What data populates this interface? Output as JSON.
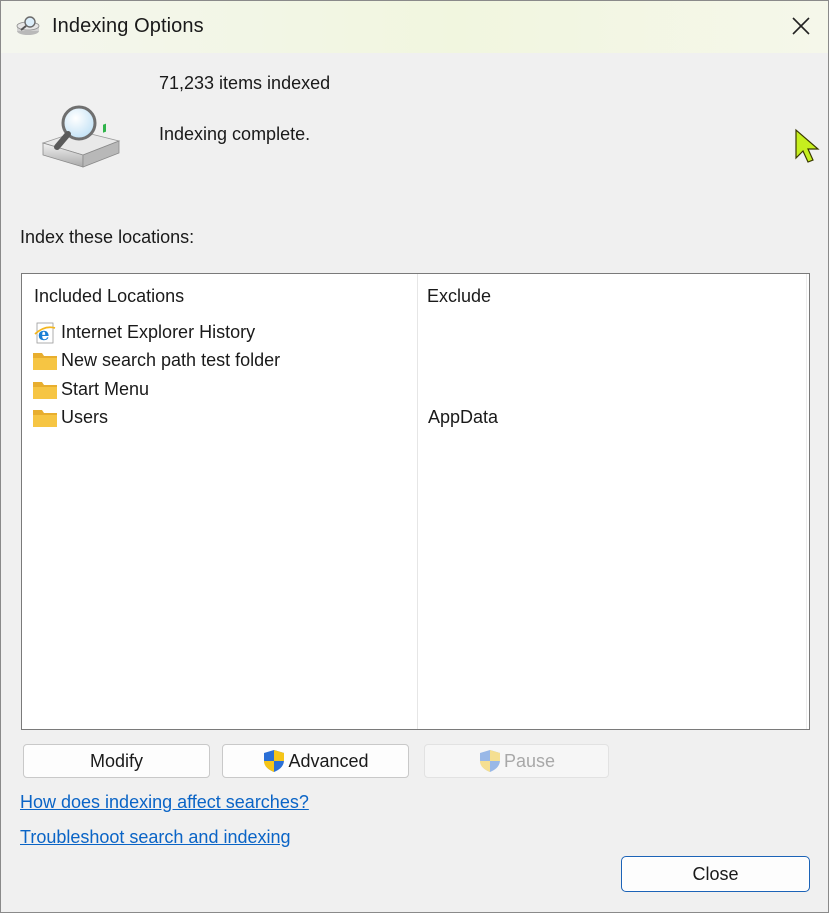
{
  "window": {
    "title": "Indexing Options"
  },
  "summary": {
    "items_indexed": "71,233 items indexed",
    "status": "Indexing complete."
  },
  "locations": {
    "label": "Index these locations:",
    "columns": {
      "included": "Included Locations",
      "exclude": "Exclude"
    },
    "rows": [
      {
        "icon": "internet-explorer-icon",
        "name": "Internet Explorer History",
        "exclude": ""
      },
      {
        "icon": "folder-icon",
        "name": "New search path test folder",
        "exclude": ""
      },
      {
        "icon": "folder-icon",
        "name": "Start Menu",
        "exclude": ""
      },
      {
        "icon": "folder-icon",
        "name": "Users",
        "exclude": "AppData"
      }
    ]
  },
  "buttons": {
    "modify": "Modify",
    "advanced": "Advanced",
    "pause": "Pause",
    "close": "Close"
  },
  "links": {
    "how": "How does indexing affect searches?",
    "troubleshoot": "Troubleshoot search and indexing"
  },
  "colors": {
    "link": "#0a64c6",
    "close_border": "#1c63b7",
    "folder": "#f6c543",
    "cursor": "#c6ef1e"
  }
}
